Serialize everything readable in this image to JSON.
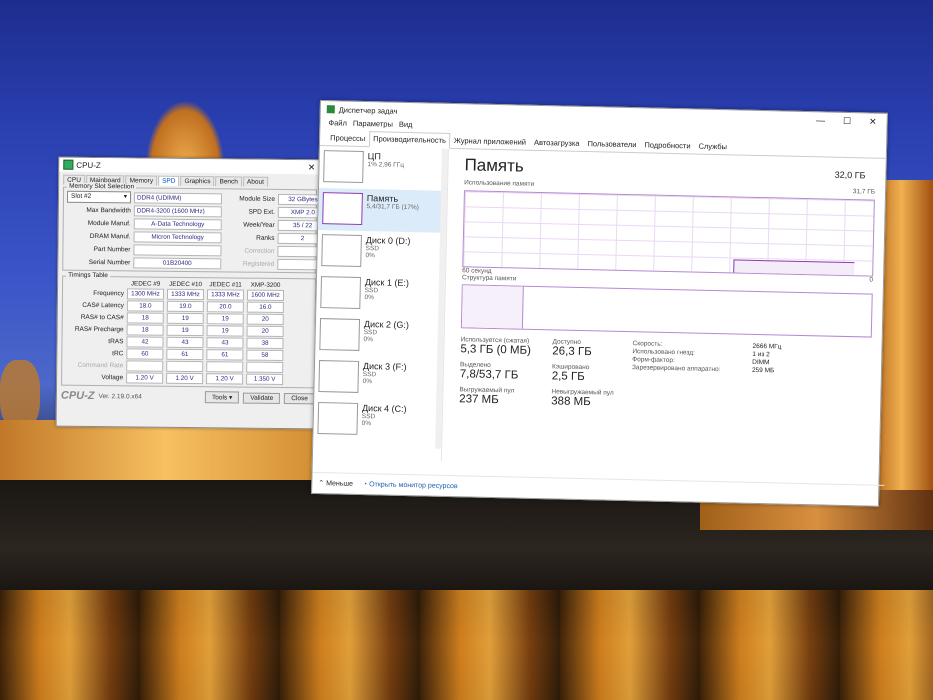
{
  "cpuz": {
    "title": "CPU-Z",
    "tabs": [
      "CPU",
      "Mainboard",
      "Memory",
      "SPD",
      "Graphics",
      "Bench",
      "About"
    ],
    "active_tab": "SPD",
    "slot_group_title": "Memory Slot Selection",
    "slot": "Slot #2",
    "type": "DDR4 (UDIMM)",
    "labels": {
      "module_size": "Module Size",
      "max_bandwidth": "Max Bandwidth",
      "spd_ext": "SPD Ext.",
      "module_manuf": "Module Manuf.",
      "week_year": "Week/Year",
      "dram_manuf": "DRAM Manuf.",
      "ranks": "Ranks",
      "part_number": "Part Number",
      "correction": "Correction",
      "serial_number": "Serial Number",
      "registered": "Registered"
    },
    "module_size": "32 GBytes",
    "max_bandwidth": "DDR4-3200 (1600 MHz)",
    "spd_ext": "XMP 2.0",
    "module_manuf": "A-Data Technology",
    "week_year": "35 / 22",
    "dram_manuf": "Micron Technology",
    "ranks": "2",
    "part_number": "",
    "serial_number": "01B20400",
    "timings_title": "Timings Table",
    "timings_headers": [
      "JEDEC #9",
      "JEDEC #10",
      "JEDEC #11",
      "XMP-3200"
    ],
    "timings": [
      {
        "label": "Frequency",
        "values": [
          "1300 MHz",
          "1333 MHz",
          "1333 MHz",
          "1600 MHz"
        ]
      },
      {
        "label": "CAS# Latency",
        "values": [
          "18.0",
          "19.0",
          "20.0",
          "16.0"
        ]
      },
      {
        "label": "RAS# to CAS#",
        "values": [
          "18",
          "19",
          "19",
          "20"
        ]
      },
      {
        "label": "RAS# Precharge",
        "values": [
          "18",
          "19",
          "19",
          "20"
        ]
      },
      {
        "label": "tRAS",
        "values": [
          "42",
          "43",
          "43",
          "38"
        ]
      },
      {
        "label": "tRC",
        "values": [
          "60",
          "61",
          "61",
          "58"
        ]
      },
      {
        "label": "Command Rate",
        "values": [
          "",
          "",
          "",
          ""
        ]
      },
      {
        "label": "Voltage",
        "values": [
          "1.20 V",
          "1.20 V",
          "1.20 V",
          "1.350 V"
        ]
      }
    ],
    "logo": "CPU-Z",
    "version": "Ver. 2.19.0.x64",
    "tools_label": "Tools",
    "validate_label": "Validate",
    "close_label": "Close"
  },
  "taskmgr": {
    "title": "Диспетчер задач",
    "menu": [
      "Файл",
      "Параметры",
      "Вид"
    ],
    "tabs": [
      "Процессы",
      "Производительность",
      "Журнал приложений",
      "Автозагрузка",
      "Пользователи",
      "Подробности",
      "Службы"
    ],
    "active_tab": "Производительность",
    "side_items": [
      {
        "name": "ЦП",
        "sub": "1% 2,96 ГГц",
        "sub2": ""
      },
      {
        "name": "Память",
        "sub": "5,4/31,7 ГБ (17%)",
        "sub2": ""
      },
      {
        "name": "Диск 0 (D:)",
        "sub": "SSD",
        "sub2": "0%"
      },
      {
        "name": "Диск 1 (E:)",
        "sub": "SSD",
        "sub2": "0%"
      },
      {
        "name": "Диск 2 (G:)",
        "sub": "SSD",
        "sub2": "0%"
      },
      {
        "name": "Диск 3 (F:)",
        "sub": "SSD",
        "sub2": "0%"
      },
      {
        "name": "Диск 4 (C:)",
        "sub": "SSD",
        "sub2": "0%"
      }
    ],
    "heading": "Память",
    "total": "32,0 ГБ",
    "usage_label": "Использование памяти",
    "usage_max": "31,7 ГБ",
    "time_label": "60 секунд",
    "zero": "0",
    "structure_label": "Структура памяти",
    "stats": {
      "in_use_label": "Используется (сжатая)",
      "in_use": "5,3 ГБ (0 МБ)",
      "available_label": "Доступно",
      "available": "26,3 ГБ",
      "committed_label": "Выделено",
      "committed": "7,8/53,7 ГБ",
      "cached_label": "Кэшировано",
      "cached": "2,5 ГБ",
      "paged_label": "Выгружаемый пул",
      "paged": "237 МБ",
      "nonpaged_label": "Невыгружаемый пул",
      "nonpaged": "388 МБ"
    },
    "props": [
      {
        "k": "Скорость:",
        "v": "2666 МГц"
      },
      {
        "k": "Использовано гнезд:",
        "v": "1 из 2"
      },
      {
        "k": "Форм-фактор:",
        "v": "DIMM"
      },
      {
        "k": "Зарезервировано аппаратно:",
        "v": "259 МБ"
      }
    ],
    "less_label": "Меньше",
    "resmon_label": "Открыть монитор ресурсов"
  },
  "colors": {
    "memory_accent": "#8a3ab0",
    "cpu_accent": "#1a6fc8",
    "link": "#1a5fb4"
  }
}
